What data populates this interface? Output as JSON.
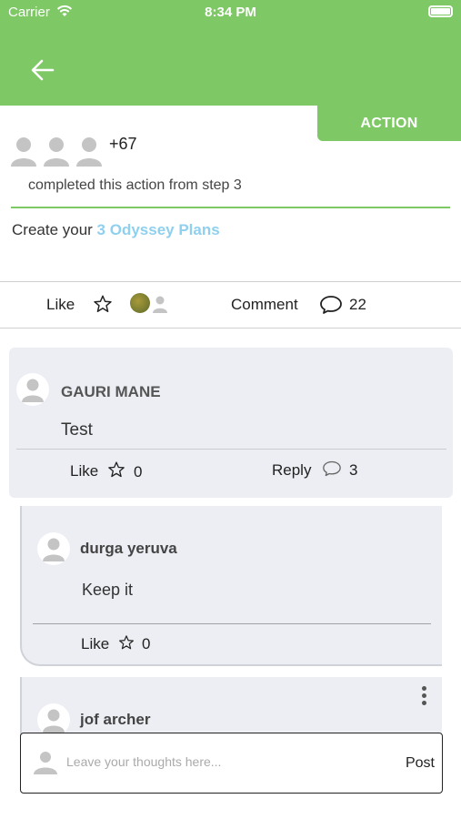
{
  "status": {
    "carrier": "Carrier",
    "time": "8:34 PM"
  },
  "action_tab": "ACTION",
  "participants": {
    "extra_count": "+67"
  },
  "completed_text": "completed this action from step 3",
  "create": {
    "prefix": "Create your ",
    "link": "3 Odyssey Plans"
  },
  "actionbar": {
    "like": "Like",
    "comment": "Comment",
    "comment_count": "22"
  },
  "comments": [
    {
      "name": "GAURI MANE",
      "text": "Test",
      "like_label": "Like",
      "like_count": "0",
      "reply_label": "Reply",
      "reply_count": "3"
    },
    {
      "name": "durga yeruva",
      "text": "Keep it",
      "like_label": "Like",
      "like_count": "0"
    },
    {
      "name": "jof archer"
    }
  ],
  "input": {
    "placeholder": "Leave your thoughts here...",
    "post_label": "Post"
  },
  "colors": {
    "brand_green": "#7ec865",
    "link_blue": "#8fd0ef",
    "comment_bg": "#eceef3"
  }
}
